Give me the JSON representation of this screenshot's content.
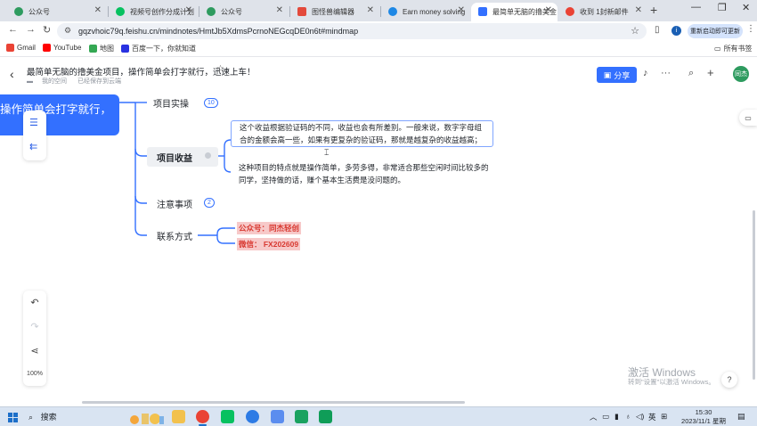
{
  "browser": {
    "tabs": [
      {
        "title": "公众号",
        "active": false,
        "favicon_color": "#2e9b5f"
      },
      {
        "title": "视频号创作分成计划",
        "active": false,
        "favicon_color": "#07c160"
      },
      {
        "title": "公众号",
        "active": false,
        "favicon_color": "#2e9b5f"
      },
      {
        "title": "图怪兽编辑器",
        "active": false,
        "favicon_color": "#e3493b"
      },
      {
        "title": "Earn money solving",
        "active": false,
        "favicon_color": "#1e88e5"
      },
      {
        "title": "最简单无脑的撸美金",
        "active": true,
        "favicon_color": "#3370ff"
      },
      {
        "title": "收到 1封新邮件",
        "active": false,
        "favicon_color": "#ea4335"
      }
    ],
    "url": "gqzvhoic79q.feishu.cn/mindnotes/HmtJb5XdmsPcrnoNEGcqDE0n6t#mindmap",
    "restart_label": "重新启动即可更新",
    "bookmarks": [
      {
        "label": "Gmail",
        "color": "#ea4335"
      },
      {
        "label": "YouTube",
        "color": "#ff0000"
      },
      {
        "label": "地图",
        "color": "#34a853"
      },
      {
        "label": "百度一下，你就知道",
        "color": "#2932e1"
      }
    ],
    "all_bookmarks_label": "所有书签"
  },
  "doc": {
    "title": "最简单无脑的撸美金项目，操作简单会打字就行，迅速上车！",
    "space": "我的空间",
    "saved": "已经保存到云端",
    "share_label": "分享",
    "avatar_text": "同杰"
  },
  "mindmap": {
    "root_text": "操作简单会打字就行，",
    "nodes": {
      "project_practice": {
        "label": "项目实操",
        "badge": "10"
      },
      "project_income": {
        "label": "项目收益"
      },
      "notes": {
        "label": "注意事项",
        "badge": "2"
      },
      "contact": {
        "label": "联系方式"
      }
    },
    "income_text_1": "这个收益根据验证码的不同，收益也会有所差别。一般来说，数字字母组合的金额会高一些，如果有更复杂的验证码，那就是越复杂的收益越高；",
    "income_text_2": "这种项目的特点就是操作简单，多劳多得，非常适合那些空闲时间比较多的同学，坚持做的话，赚个基本生活费是没问题的。",
    "contact_public": "公众号：同杰轻创",
    "contact_wechat": "微信： FX202609"
  },
  "zoom": {
    "level": "100%"
  },
  "watermark": {
    "line1": "激活 Windows",
    "line2": "转到\"设置\"以激活 Windows。"
  },
  "taskbar": {
    "search_label": "搜索",
    "apps": [
      {
        "name": "file-explorer",
        "color": "#f2c14e"
      },
      {
        "name": "chrome",
        "color": "#ea4335"
      },
      {
        "name": "wechat",
        "color": "#07c160"
      },
      {
        "name": "app-blue",
        "color": "#2d7be5"
      },
      {
        "name": "app-notes",
        "color": "#5b8def"
      },
      {
        "name": "app-green",
        "color": "#1aa260"
      },
      {
        "name": "app-sheets",
        "color": "#0f9d58"
      }
    ],
    "ime": "英",
    "time": "15:30",
    "date": "2023/11/1 星期三"
  }
}
